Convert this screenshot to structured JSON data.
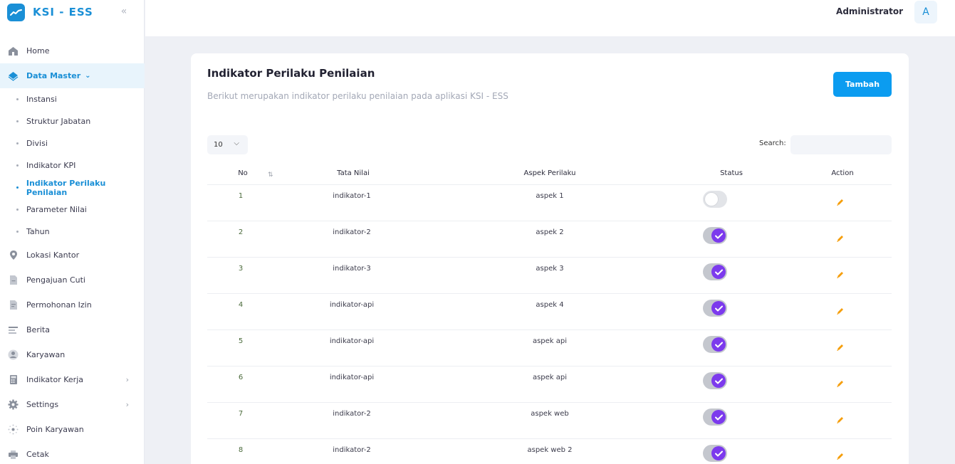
{
  "brand": {
    "name": "KSI - ESS",
    "accent": "#1a8fd6"
  },
  "sidebar": {
    "items": [
      {
        "label": "Home",
        "icon": "home-icon"
      },
      {
        "label": "Data Master",
        "icon": "diamond-icon",
        "active": true,
        "children": [
          {
            "label": "Instansi"
          },
          {
            "label": "Struktur Jabatan"
          },
          {
            "label": "Divisi"
          },
          {
            "label": "Indikator KPI"
          },
          {
            "label": "Indikator Perilaku Penilaian",
            "active": true
          },
          {
            "label": "Parameter Nilai"
          },
          {
            "label": "Tahun"
          }
        ]
      },
      {
        "label": "Lokasi Kantor",
        "icon": "location-pin-icon"
      },
      {
        "label": "Pengajuan Cuti",
        "icon": "document-icon"
      },
      {
        "label": "Permohonan Izin",
        "icon": "document-lines-icon"
      },
      {
        "label": "Berita",
        "icon": "news-icon"
      },
      {
        "label": "Karyawan",
        "icon": "user-icon"
      },
      {
        "label": "Indikator Kerja",
        "icon": "calculator-icon",
        "expandable": true
      },
      {
        "label": "Settings",
        "icon": "gear-icon",
        "expandable": true
      },
      {
        "label": "Poin Karyawan",
        "icon": "sparkle-icon"
      },
      {
        "label": "Cetak",
        "icon": "printer-icon"
      }
    ]
  },
  "header": {
    "user_name": "Administrator",
    "avatar_letter": "A"
  },
  "card": {
    "title": "Indikator Perilaku Penilaian",
    "subtitle": "Berikut merupakan indikator perilaku penilaian pada aplikasi KSI - ESS",
    "add_button": "Tambah",
    "page_length": "10",
    "search_label": "Search:",
    "columns": [
      "No",
      "Tata Nilai",
      "Aspek Perilaku",
      "Status",
      "Action"
    ],
    "rows": [
      {
        "no": "1",
        "tata_nilai": "indikator-1",
        "aspek": "aspek 1",
        "status": false
      },
      {
        "no": "2",
        "tata_nilai": "indikator-2",
        "aspek": "aspek 2",
        "status": true
      },
      {
        "no": "3",
        "tata_nilai": "indikator-3",
        "aspek": "aspek 3",
        "status": true
      },
      {
        "no": "4",
        "tata_nilai": "indikator-api",
        "aspek": "aspek 4",
        "status": true
      },
      {
        "no": "5",
        "tata_nilai": "indikator-api",
        "aspek": "aspek api",
        "status": true
      },
      {
        "no": "6",
        "tata_nilai": "indikator-api",
        "aspek": "aspek api",
        "status": true
      },
      {
        "no": "7",
        "tata_nilai": "indikator-2",
        "aspek": "aspek web",
        "status": true
      },
      {
        "no": "8",
        "tata_nilai": "indikator-2",
        "aspek": "aspek web 2",
        "status": true
      }
    ]
  },
  "colors": {
    "primary_button": "#0b9cf0",
    "toggle_on": "#7c3aed",
    "edit_icon": "#f59e0b"
  }
}
